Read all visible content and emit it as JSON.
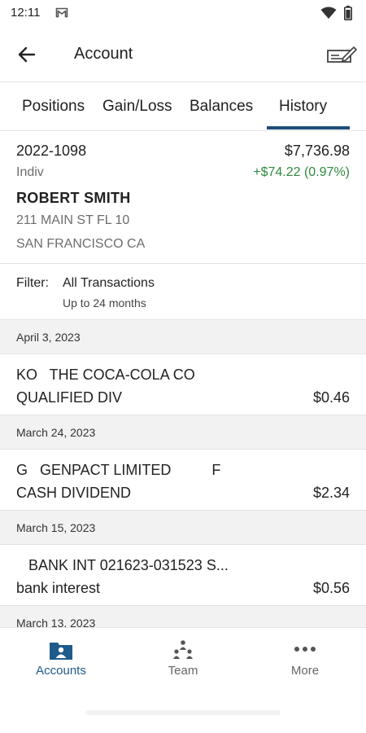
{
  "status_bar": {
    "time": "12:11"
  },
  "app_bar": {
    "title": "Account"
  },
  "tabs": [
    {
      "label": "Positions",
      "active": false
    },
    {
      "label": "Gain/Loss",
      "active": false
    },
    {
      "label": "Balances",
      "active": false
    },
    {
      "label": "History",
      "active": true
    }
  ],
  "account": {
    "number": "2022-1098",
    "value": "$7,736.98",
    "type": "Indiv",
    "change": "+$74.22 (0.97%)",
    "owner": "ROBERT SMITH",
    "address_line1": "211 MAIN ST FL 10",
    "address_line2": "SAN FRANCISCO CA"
  },
  "filter": {
    "label": "Filter:",
    "value": "All Transactions",
    "range": "Up to 24 months"
  },
  "history": [
    {
      "date": "April 3, 2023",
      "description": "KO   THE COCA-COLA CO",
      "type": "QUALIFIED DIV",
      "amount": "$0.46"
    },
    {
      "date": "March 24, 2023",
      "description": "G   GENPACT LIMITED          F",
      "type": "CASH DIVIDEND",
      "amount": "$2.34"
    },
    {
      "date": "March 15, 2023",
      "description": "   BANK INT 021623-031523 S...",
      "type": "bank interest",
      "amount": "$0.56"
    },
    {
      "date": "March 13, 2023"
    }
  ],
  "bottom_nav": [
    {
      "label": "Accounts",
      "active": true
    },
    {
      "label": "Team",
      "active": false
    },
    {
      "label": "More",
      "active": false
    }
  ],
  "colors": {
    "accent": "#1e4e7a",
    "positive": "#2f8a3e",
    "nav_active": "#1e5a8a"
  },
  "icons": [
    "mail-icon",
    "wifi-icon",
    "battery-icon",
    "back-arrow-icon",
    "edit-check-icon",
    "accounts-icon",
    "team-icon",
    "more-icon"
  ]
}
